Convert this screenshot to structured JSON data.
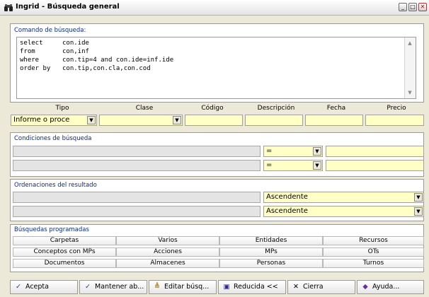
{
  "window": {
    "title": "Ingrid - Búsqueda general"
  },
  "icons": {
    "app": "binoculars-icon",
    "minimize": "minimize-icon",
    "maximize": "maximize-icon",
    "close": "close-icon"
  },
  "command": {
    "label": "Comando de búsqueda:",
    "lines": [
      {
        "kw": "select",
        "text": "con.ide"
      },
      {
        "kw": "from",
        "text": "con,inf"
      },
      {
        "kw": "where",
        "text": "con.tip=4 and con.ide=inf.ide"
      },
      {
        "kw": "order by",
        "text": "con.tip,con.cla,con.cod"
      }
    ]
  },
  "filters": {
    "headers": {
      "tipo": "Tipo",
      "clase": "Clase",
      "codigo": "Código",
      "descripcion": "Descripción",
      "fecha": "Fecha",
      "precio": "Precio"
    },
    "tipo_value": "Informe o proce",
    "clase_value": "",
    "codigo_value": "",
    "descripcion_value": "",
    "fecha_value": "",
    "precio_value": ""
  },
  "conditions": {
    "label": "Condiciones de búsqueda",
    "rows": [
      {
        "field": "",
        "operator": "=",
        "value": ""
      },
      {
        "field": "",
        "operator": "=",
        "value": ""
      }
    ]
  },
  "orderings": {
    "label": "Ordenaciones del resultado",
    "rows": [
      {
        "field": "",
        "direction": "Ascendente"
      },
      {
        "field": "",
        "direction": "Ascendente"
      }
    ]
  },
  "scheduled": {
    "label": "Búsquedas programadas",
    "rows": [
      [
        "Carpetas",
        "Varios",
        "Entidades",
        "Recursos"
      ],
      [
        "Conceptos con MPs",
        "Acciones",
        "MPs",
        "OTs"
      ],
      [
        "Documentos",
        "Almacenes",
        "Personas",
        "Turnos"
      ]
    ]
  },
  "buttons": {
    "acepta": "Acepta",
    "mantener": "Mantener ab...",
    "editar": "Editar búsq...",
    "reducida": "Reducida <<",
    "cierra": "Cierra",
    "ayuda": "Ayuda..."
  },
  "colors": {
    "section_label": "#0a2a8a",
    "input_yellow": "#ffffc6",
    "background": "#ece9d8"
  }
}
